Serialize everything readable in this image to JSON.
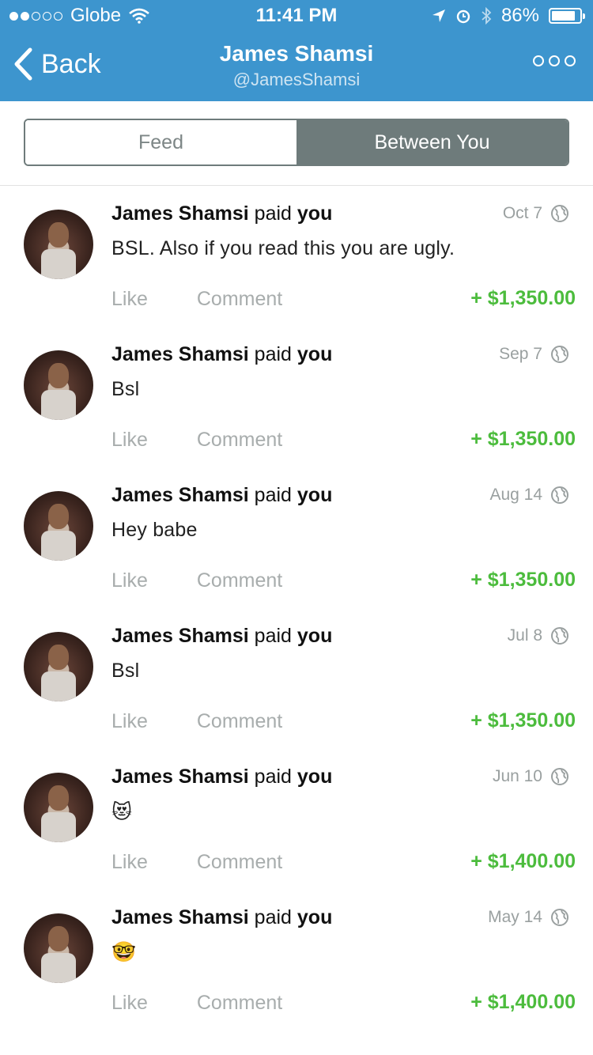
{
  "status": {
    "carrier": "Globe",
    "time": "11:41 PM",
    "battery_text": "86%",
    "battery_level": 0.86,
    "signal_bars": 2
  },
  "nav": {
    "back_label": "Back",
    "title": "James Shamsi",
    "subtitle": "@JamesShamsi"
  },
  "tabs": [
    {
      "label": "Feed",
      "active": false
    },
    {
      "label": "Between You",
      "active": true
    }
  ],
  "colors": {
    "brand": "#3d95ce",
    "amount": "#4cbc3d",
    "segment": "#6e7b7b"
  },
  "feed": [
    {
      "sender": "James Shamsi",
      "verb": "paid",
      "recipient": "you",
      "date": "Oct 7",
      "note": "BSL. Also if you read this you are ugly.",
      "like": "Like",
      "comment": "Comment",
      "amount": "+ $1,350.00"
    },
    {
      "sender": "James Shamsi",
      "verb": "paid",
      "recipient": "you",
      "date": "Sep 7",
      "note": "Bsl",
      "like": "Like",
      "comment": "Comment",
      "amount": "+ $1,350.00"
    },
    {
      "sender": "James Shamsi",
      "verb": "paid",
      "recipient": "you",
      "date": "Aug 14",
      "note": "Hey babe",
      "like": "Like",
      "comment": "Comment",
      "amount": "+ $1,350.00"
    },
    {
      "sender": "James Shamsi",
      "verb": "paid",
      "recipient": "you",
      "date": "Jul 8",
      "note": "Bsl",
      "like": "Like",
      "comment": "Comment",
      "amount": "+ $1,350.00"
    },
    {
      "sender": "James Shamsi",
      "verb": "paid",
      "recipient": "you",
      "date": "Jun 10",
      "note": "😻",
      "like": "Like",
      "comment": "Comment",
      "amount": "+ $1,400.00"
    },
    {
      "sender": "James Shamsi",
      "verb": "paid",
      "recipient": "you",
      "date": "May 14",
      "note": "🤓",
      "like": "Like",
      "comment": "Comment",
      "amount": "+ $1,400.00"
    }
  ]
}
